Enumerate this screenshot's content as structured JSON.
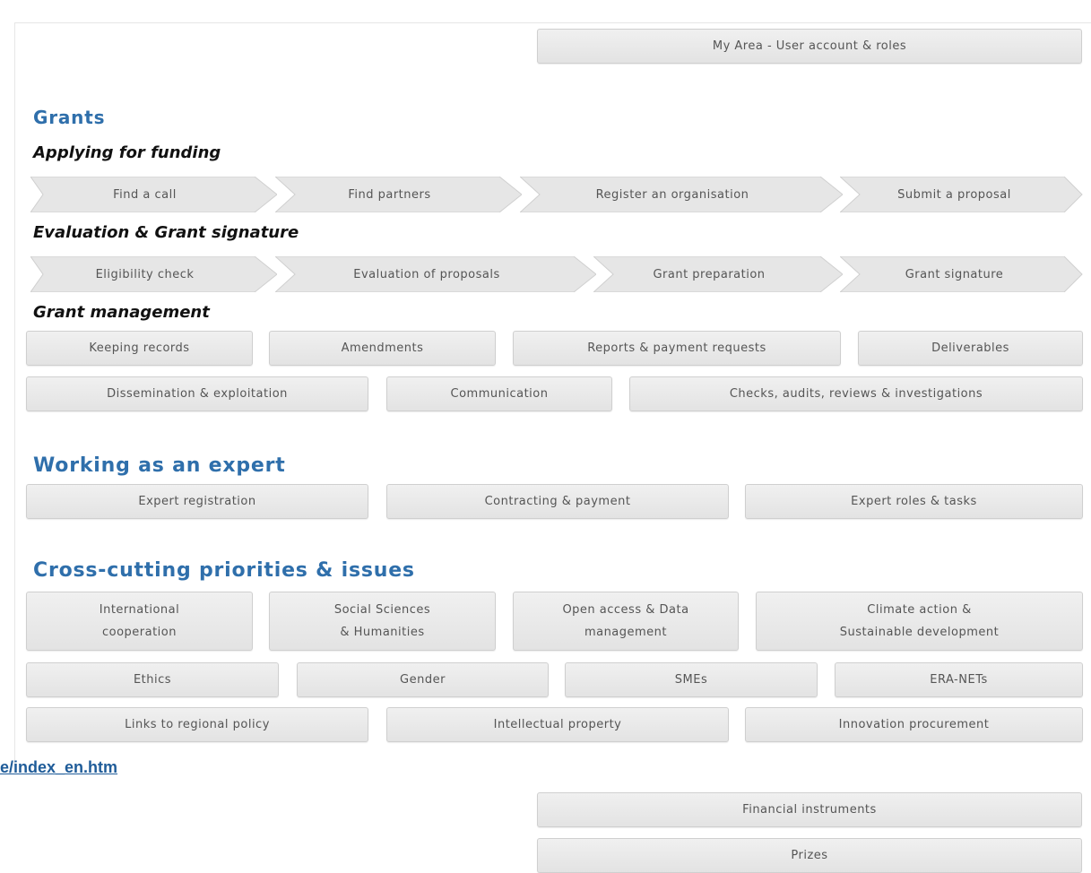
{
  "my_area": "My Area - User account & roles",
  "grants": {
    "title": "Grants",
    "applying": {
      "title": "Applying for funding",
      "steps": [
        "Find a call",
        "Find partners",
        "Register an organisation",
        "Submit a proposal"
      ]
    },
    "evaluation": {
      "title": "Evaluation & Grant signature",
      "steps": [
        "Eligibility check",
        "Evaluation of proposals",
        "Grant preparation",
        "Grant signature"
      ]
    },
    "management": {
      "title": "Grant management",
      "row1": [
        "Keeping records",
        "Amendments",
        "Reports & payment requests",
        "Deliverables"
      ],
      "row2": [
        "Dissemination & exploitation",
        "Communication",
        "Checks, audits, reviews & investigations"
      ]
    }
  },
  "expert": {
    "title": "Working as an expert",
    "items": [
      "Expert registration",
      "Contracting & payment",
      "Expert roles & tasks"
    ]
  },
  "cross": {
    "title": "Cross-cutting priorities & issues",
    "row1": [
      "International\ncooperation",
      "Social Sciences\n& Humanities",
      "Open access & Data\nmanagement",
      "Climate action &\nSustainable development"
    ],
    "row2": [
      "Ethics",
      "Gender",
      "SMEs",
      "ERA-NETs"
    ],
    "row3": [
      "Links to regional policy",
      "Intellectual property",
      "Innovation procurement"
    ]
  },
  "link_text": "e/index_en.htm",
  "bottom": [
    "Financial instruments",
    "Prizes"
  ],
  "colors": {
    "heading": "#2f6fab",
    "button_bg": "#e9e9e9",
    "button_text": "#555555",
    "link": "#1f5c99"
  }
}
